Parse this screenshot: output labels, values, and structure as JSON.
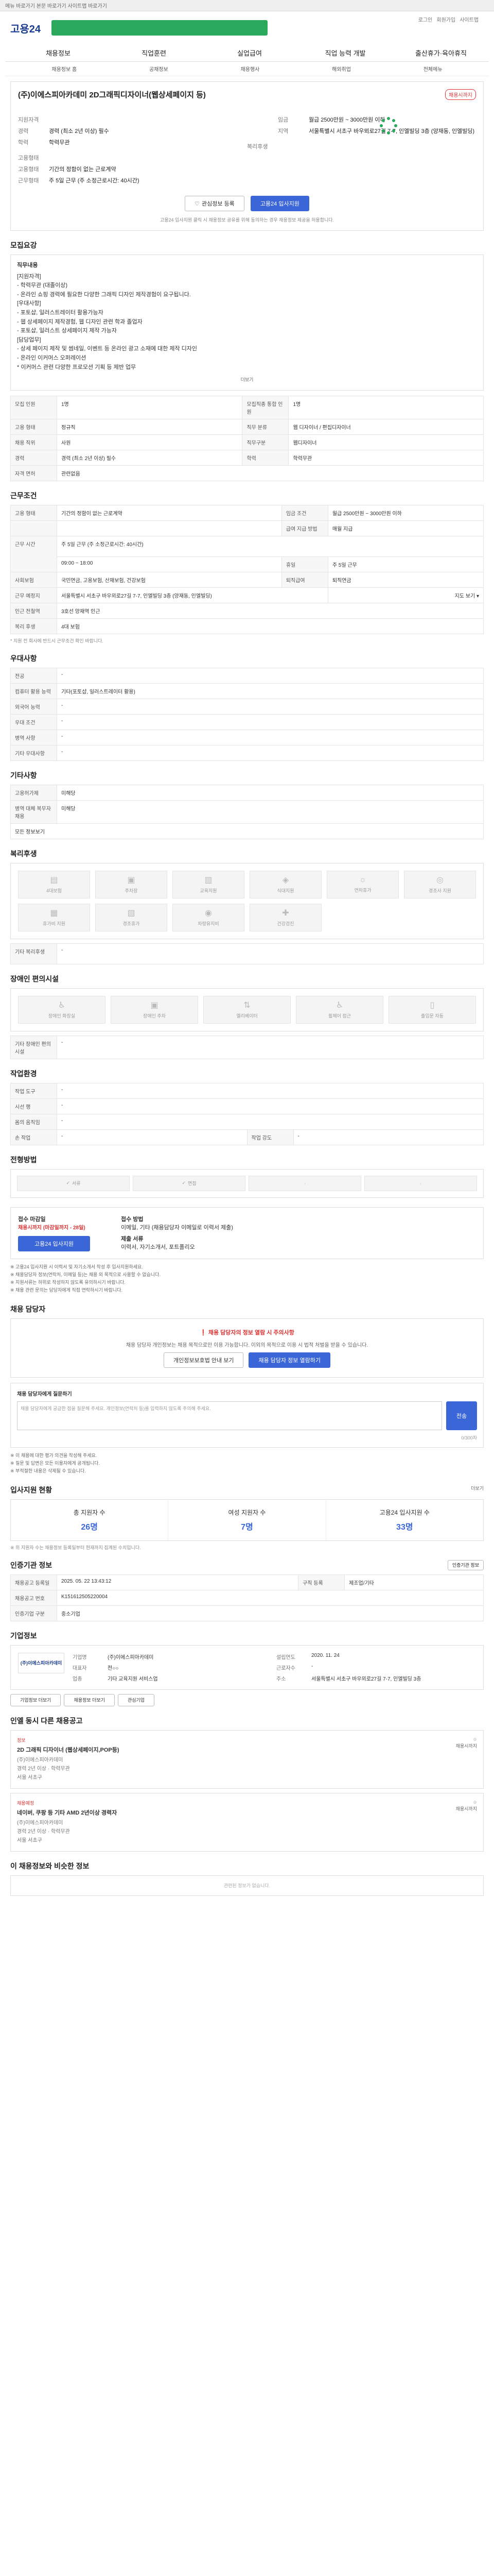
{
  "topbar": {
    "text": "메뉴 바로가기 본문 바로가기 사이트맵 바로가기"
  },
  "header": {
    "logo": "고용24",
    "links": [
      "로그인",
      "회원가입",
      "사이트맵"
    ]
  },
  "gnb": [
    "채용정보",
    "직업훈련",
    "실업급여",
    "직업 능력 개발",
    "출산휴가·육아휴직"
  ],
  "subnav": [
    "채용정보 홈",
    "공채정보",
    "채용행사",
    "해외취업",
    "전체메뉴"
  ],
  "hero": {
    "title": "(주)이에스피아카데미 2D그래픽디자이너(웹상세페이지 등)",
    "tag": "채용시까지",
    "left": [
      {
        "k": "지원자격",
        "v": ""
      },
      {
        "k": "경력",
        "v": "경력 (최소 2년 이상) 필수"
      },
      {
        "k": "학력",
        "v": "학력무관"
      },
      {
        "k": "고용형태",
        "v": ""
      },
      {
        "k": "고용형태",
        "v": "기간의 정함이 없는 근로계약"
      },
      {
        "k": "근무형태",
        "v": "주 5일 근무 (주 소정근로시간: 40시간)"
      }
    ],
    "right": [
      {
        "k": "임금",
        "v": "월급 2500만원 ~ 3000만원 이하"
      },
      {
        "k": "지역",
        "v": "서울특별시 서초구 바우뫼로27길 7-7, 인엘빌딩 3층 (양재동, 인엘빌딩)"
      },
      {
        "k": "복리후생",
        "v": ""
      }
    ],
    "buttons": {
      "scrap": "관심정보 등록",
      "apply": "고용24 입사지원"
    },
    "notice": "고용24 입사지원 클릭 시 채용정보 공유를 위해 동의하는 경우 채용정보 제공을 허용합니다."
  },
  "sections": {
    "job_desc": {
      "title": "모집요강",
      "heading": "직무내용",
      "lines": [
        "[지원자격]",
        " - 학력무관 (대졸이상)",
        " - 온라인 쇼핑 경력에 필요한 다양한 그래픽 디자인 제작경험이 요구됩니다.",
        "[우대사항]",
        " - 포토샵, 일러스트레이터 활용가능자",
        " - 웹 상세페이지 제작경험, 웹 디자인 관련 학과 졸업자",
        " - 포토샵, 일러스트 상세페이지 제작 가능자",
        "[담당업무]",
        " - 상세 페이지 제작 및 썸네일, 이벤트 등 온라인 광고 소재에 대한 제작 디자인",
        " - 온라인 이커머스 오퍼레이션",
        "   * 이커머스 관련 다양한 프로모션 기획 등 제반 업무"
      ],
      "more": "더보기"
    },
    "job_table": [
      [
        "모집 인원",
        "1명",
        "모집직종 통합 인원",
        "1명"
      ],
      [
        "고용 형태",
        "정규직",
        "직무 분류",
        "웹 디자이너 / 편집디자이너"
      ],
      [
        "채용 직위",
        "사원",
        "직무구분",
        "웹디자이너"
      ],
      [
        "경력",
        "경력 (최소 2년 이상) 필수",
        "학력",
        "학력무관"
      ],
      [
        "자격 면허",
        "관련없음",
        "",
        ""
      ]
    ],
    "work_cond": {
      "title": "근무조건",
      "rows": [
        [
          "고용 형태",
          "기간의 정함이 없는 근로계약",
          "임금 조건",
          "월급 2500만원 ~ 3000만원 이하"
        ],
        [
          "",
          "",
          "급여 지급 방법",
          "매월 지급"
        ],
        [
          "근무 시간",
          "주 5일 근무 (주 소정근로시간: 40시간)",
          "",
          ""
        ],
        [
          "",
          "09:00 ~ 18:00",
          "휴일",
          "주 5일 근무"
        ],
        [
          "사회보험",
          "국민연금, 고용보험, 산재보험, 건강보험",
          "퇴직급여",
          "퇴직연금"
        ],
        [
          "근무 예정지",
          "서울특별시 서초구 바우뫼로27길 7-7, 인엘빌딩 3층 (양재동, 인엘빌딩)",
          "",
          "지도 보기 ▾"
        ],
        [
          "인근 전철역",
          "3호선 양재역 인근",
          "",
          ""
        ],
        [
          "복리 후생",
          "4대 보험",
          "",
          ""
        ]
      ],
      "note": "* 지원 전 회사에 반드시 근무조건 확인 바랍니다."
    },
    "preference": {
      "title": "우대사항",
      "rows": [
        [
          "전공",
          "-"
        ],
        [
          "컴퓨터 활용 능력",
          "기타(포토샵, 일러스트레이터 활용)"
        ],
        [
          "외국어 능력",
          "-"
        ],
        [
          "우대 조건",
          "-"
        ],
        [
          "병역 사항",
          "-"
        ],
        [
          "기타 우대사항",
          "-"
        ]
      ]
    },
    "etc": {
      "title": "기타사항",
      "rows": [
        [
          "고용허가제",
          "미해당"
        ],
        [
          "병역 대체 복무자 채용",
          "미해당"
        ]
      ],
      "more": "모든 정보보기"
    },
    "welfare": {
      "title": "복리후생",
      "items": [
        "4대보험",
        "주차장",
        "교육지원",
        "식대지원",
        "연차휴가",
        "경조사 지원",
        "휴가비 지원",
        "경조휴가",
        "차량유지비",
        "건강검진",
        "",
        ""
      ],
      "etc_label": "기타 복리후생",
      "etc_value": "-"
    },
    "disability": {
      "title": "장애인 편의시설",
      "items": [
        "장애인 화장실",
        "장애인 주차",
        "엘리베이터",
        "휠체어 접근",
        "출입문 자동"
      ],
      "etc_label": "기타 장애인 편의시설",
      "etc_value": "-"
    },
    "work_env": {
      "title": "작업환경",
      "rows": [
        [
          "작업 도구",
          "-",
          "",
          ""
        ],
        [
          "시선 행",
          "-",
          "",
          ""
        ],
        [
          "몸의 움직임",
          "-",
          "",
          ""
        ],
        [
          "손 작업",
          "-",
          "작업 강도",
          "-"
        ]
      ]
    },
    "screening": {
      "title": "전형방법",
      "steps": [
        "서류",
        "면접",
        "",
        ""
      ]
    },
    "apply": {
      "title": "접수 마감일",
      "deadline": "채용시까지 (마감일까지 - 28일)",
      "method_label": "접수 방법",
      "method": "이메일, 기타 (채용담당자 이메일로 이력서 제출)",
      "docs_label": "제출 서류",
      "docs": "이력서, 자기소개서, 포트폴리오",
      "apply_btn": "고용24 입사지원",
      "bullets": [
        "※ 고용24 입사지원 시 이력서 및 자기소개서 작성 후 입사지원하세요.",
        "※ 채용담당자 정보(연락처, 이메일 등)는 채용 외 목적으로 사용할 수 없습니다.",
        "※ 지원서류는 허위로 작성하지 않도록 유의하시기 바랍니다.",
        "※ 채용 관련 문의는 담당자에게 직접 연락하시기 바랍니다."
      ]
    },
    "manager": {
      "title": "채용 담당자",
      "warn": "채용 담당자의 정보 열람 시 주의사항",
      "desc": "채용 담당자 개인정보는 채용 목적으로만 이용 가능합니다. 이외의 목적으로 이용 시 법적 처벌을 받을 수 있습니다.",
      "btn_consent": "개인정보보호법 안내 보기",
      "btn_view": "채용 담당자 정보 열람하기",
      "qa_label": "채용 담당자에게 질문하기",
      "qa_placeholder": "채용 담당자에게 궁금한 점을 질문해 주세요. 개인정보(연락처 등)를 입력하지 않도록 주의해 주세요.",
      "qa_btn": "전송",
      "qa_count": "0/300자",
      "bullets": [
        "※ 이 채용에 대한 평가 의견을 작성해 주세요.",
        "※ 질문 및 답변은 모든 이용자에게 공개됩니다.",
        "※ 부적절한 내용은 삭제될 수 있습니다."
      ]
    },
    "applicants": {
      "title": "입사지원 현황",
      "more": "더보기",
      "stats": [
        {
          "label": "총 지원자 수",
          "value": "26명"
        },
        {
          "label": "여성 지원자 수",
          "value": "7명"
        },
        {
          "label": "고용24 입사지원 수",
          "value": "33명"
        }
      ],
      "note": "※ 위 지원자 수는 채용정보 등록일부터 현재까지 집계된 수치입니다."
    },
    "info": {
      "title": "인증기관 정보",
      "rows": [
        [
          "채용공고 등록일",
          "2025. 05. 22 13:43:12",
          "구직 등록",
          "제조업/기타"
        ],
        [
          "채용공고 번호",
          "K151612505220004",
          "",
          ""
        ],
        [
          "인증기업 구분",
          "중소기업",
          "",
          ""
        ]
      ],
      "btn": "인증기관 정보"
    },
    "company": {
      "title": "기업정보",
      "logo": "(주)이에스피아카데미",
      "name_label": "기업명",
      "name": "(주)이에스피아카데미",
      "est_label": "설립연도",
      "est": "2020. 11. 24",
      "ceo_label": "대표자",
      "ceo": "전○○",
      "emp_label": "근로자수",
      "emp": "-",
      "ind_label": "업종",
      "ind": "기타 교육지원 서비스업",
      "addr_label": "주소",
      "addr": "서울특별시 서초구 바우뫼로27길 7-7, 인엘빌딩 3층",
      "btns": [
        "기업정보 더보기",
        "채용정보 더보기",
        "관심기업"
      ]
    },
    "related": {
      "title": "인엘 동시 다른 채용공고",
      "jobs": [
        {
          "tag": "정보",
          "title": "2D 그래픽 디자이너 (웹상세페이지,POP등)",
          "meta": [
            "(주)이에스피아카데미",
            "경력 2년 이상 · 학력무관",
            "서울 서초구"
          ],
          "badge": "채용시까지"
        },
        {
          "tag": "채용예정",
          "title": "네이버, 쿠팡 등 기타 AMD 2년이상 경력자",
          "meta": [
            "(주)이에스피아카데미",
            "경력 2년 이상 · 학력무관",
            "서울 서초구"
          ],
          "badge": "채용시까지"
        }
      ]
    },
    "recommend": {
      "title": "이 채용정보와 비슷한 정보",
      "empty": "관련된 정보가 없습니다."
    }
  }
}
